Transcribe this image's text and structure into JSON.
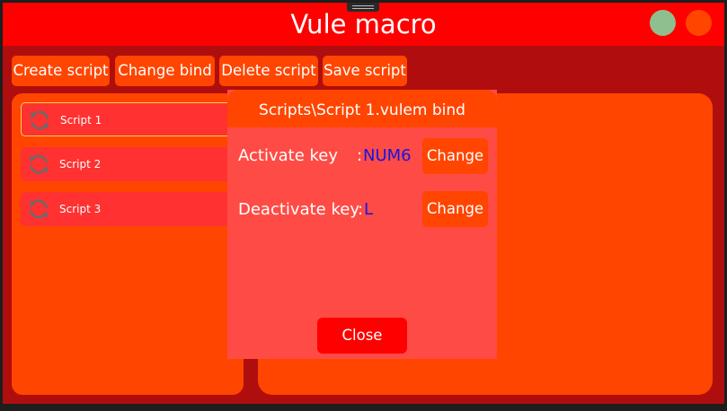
{
  "window": {
    "title": "Vule macro"
  },
  "toolbar": {
    "create_label": "Create script",
    "change_bind_label": "Change bind",
    "delete_label": "Delete script",
    "save_label": "Save script"
  },
  "scripts": {
    "items": [
      {
        "label": "Script 1",
        "selected": true,
        "icon": "refresh-icon"
      },
      {
        "label": "Script 2",
        "selected": false,
        "icon": "refresh-icon"
      },
      {
        "label": "Script 3",
        "selected": false,
        "icon": "refresh-icon"
      }
    ]
  },
  "dialog": {
    "title": "Scripts\\Script 1.vulem bind",
    "activate_label": "Activate key",
    "activate_sep": ":",
    "activate_value": "NUM6",
    "deactivate_label": "Deactivate key",
    "deactivate_sep": ":",
    "deactivate_value": "L",
    "change_label": "Change",
    "close_label": "Close"
  },
  "colors": {
    "titlebar": "#ff0000",
    "window_bg": "#b00e0e",
    "accent": "#ff4500",
    "dialog_bg": "#ff4b45",
    "script_item": "#ff3131",
    "key_value": "#1414e6",
    "minimize_dot": "#8fbf8f",
    "close_dot": "#ff4500"
  }
}
